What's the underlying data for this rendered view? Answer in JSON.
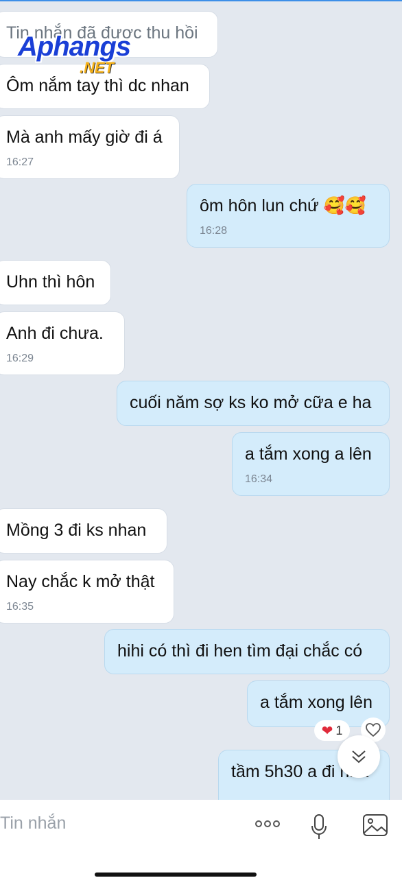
{
  "messages": [
    {
      "side": "in",
      "text": "Tin nhắn đã được thu hồi",
      "time": ""
    },
    {
      "side": "in",
      "text": "Ôm nắm tay thì dc nhan",
      "time": ""
    },
    {
      "side": "in",
      "text": "Mà anh mấy giờ đi á",
      "time": "16:27"
    },
    {
      "side": "out",
      "text": "ôm hôn lun chứ 🥰🥰",
      "time": "16:28"
    },
    {
      "side": "in",
      "text": "Uhn thì hôn",
      "time": ""
    },
    {
      "side": "in",
      "text": "Anh đi chưa.",
      "time": "16:29"
    },
    {
      "side": "out",
      "text": "cuối năm sợ ks ko mở cữa e ha",
      "time": ""
    },
    {
      "side": "out",
      "text": "a tắm xong a lên",
      "time": "16:34"
    },
    {
      "side": "in",
      "text": "Mồng 3 đi ks nhan",
      "time": ""
    },
    {
      "side": "in",
      "text": "Nay chắc k mở thật",
      "time": "16:35"
    },
    {
      "side": "out",
      "text": "hihi có thì đi hen tìm đại chắc có",
      "time": ""
    },
    {
      "side": "out",
      "text": "a tắm xong lên",
      "time": ""
    },
    {
      "side": "out",
      "text": "tầm 5h30 a đi nha",
      "time": ""
    }
  ],
  "reaction": {
    "icon": "heart",
    "count": "1"
  },
  "watermark": {
    "main": "Aphangs",
    "sub": ".NET"
  },
  "input": {
    "placeholder": "Tin nhắn"
  },
  "colors": {
    "incoming": "#ffffff",
    "outgoing": "#d4ecfb",
    "background": "#e3e8ef"
  }
}
